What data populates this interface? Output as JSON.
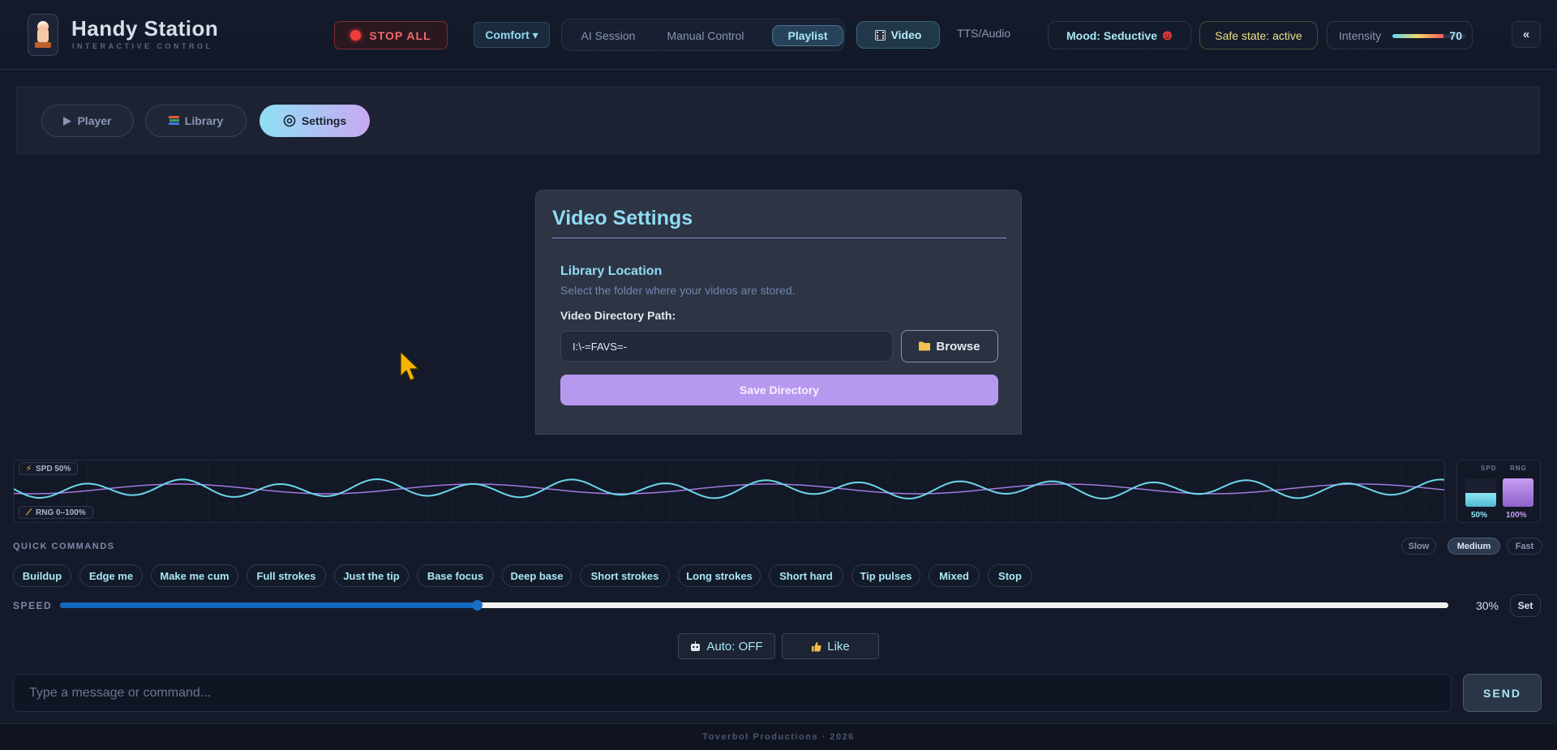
{
  "brand": {
    "title": "Handy Station",
    "subtitle": "INTERACTIVE CONTROL"
  },
  "header": {
    "stop_all": "STOP ALL",
    "profile": "Comfort ▾",
    "modes": [
      "AI Session",
      "Manual Control",
      "Playlist"
    ],
    "active_mode": "Playlist",
    "video": "Video",
    "tts": "TTS/Audio",
    "mood": "Mood: Seductive",
    "safe_state": "Safe state: active",
    "intensity_label": "Intensity",
    "intensity_value": "70",
    "intensity_level": 0.7,
    "collapse": "«"
  },
  "subnav": {
    "tabs": [
      "Player",
      "Library",
      "Settings"
    ],
    "active": "Settings"
  },
  "settings": {
    "title": "Video Settings",
    "section_title": "Library Location",
    "section_desc": "Select the folder where your videos are stored.",
    "path_label": "Video Directory Path:",
    "path_value": "I:\\-=FAVS=-",
    "browse": "Browse",
    "save": "Save Directory"
  },
  "wave": {
    "speed_tag": "SPD 50%",
    "range_tag": "RNG 0–100%",
    "spd_label": "SPD",
    "rng_label": "RNG",
    "spd_value": "50%",
    "rng_value": "100%",
    "spd_level": 0.5,
    "rng_level": 1.0
  },
  "quick": {
    "title": "QUICK COMMANDS",
    "speeds": [
      "Slow",
      "Medium",
      "Fast"
    ],
    "active_speed": "Medium",
    "commands": [
      "Buildup",
      "Edge me",
      "Make me cum",
      "Full strokes",
      "Just the tip",
      "Base focus",
      "Deep base",
      "Short strokes",
      "Long strokes",
      "Short hard",
      "Tip pulses",
      "Mixed",
      "Stop"
    ]
  },
  "speed": {
    "label": "SPEED",
    "value_text": "30%",
    "value": 0.3,
    "set": "Set"
  },
  "actions": {
    "auto": "Auto: OFF",
    "like": "Like"
  },
  "chat": {
    "placeholder": "Type a message or command...",
    "send": "SEND"
  },
  "footer": {
    "text": "Toverbol Productions  ·  2026"
  },
  "colors": {
    "accent": "#8fdcf2",
    "purple": "#b798ef",
    "stop": "#f23c3c",
    "safe": "#ece08a"
  }
}
